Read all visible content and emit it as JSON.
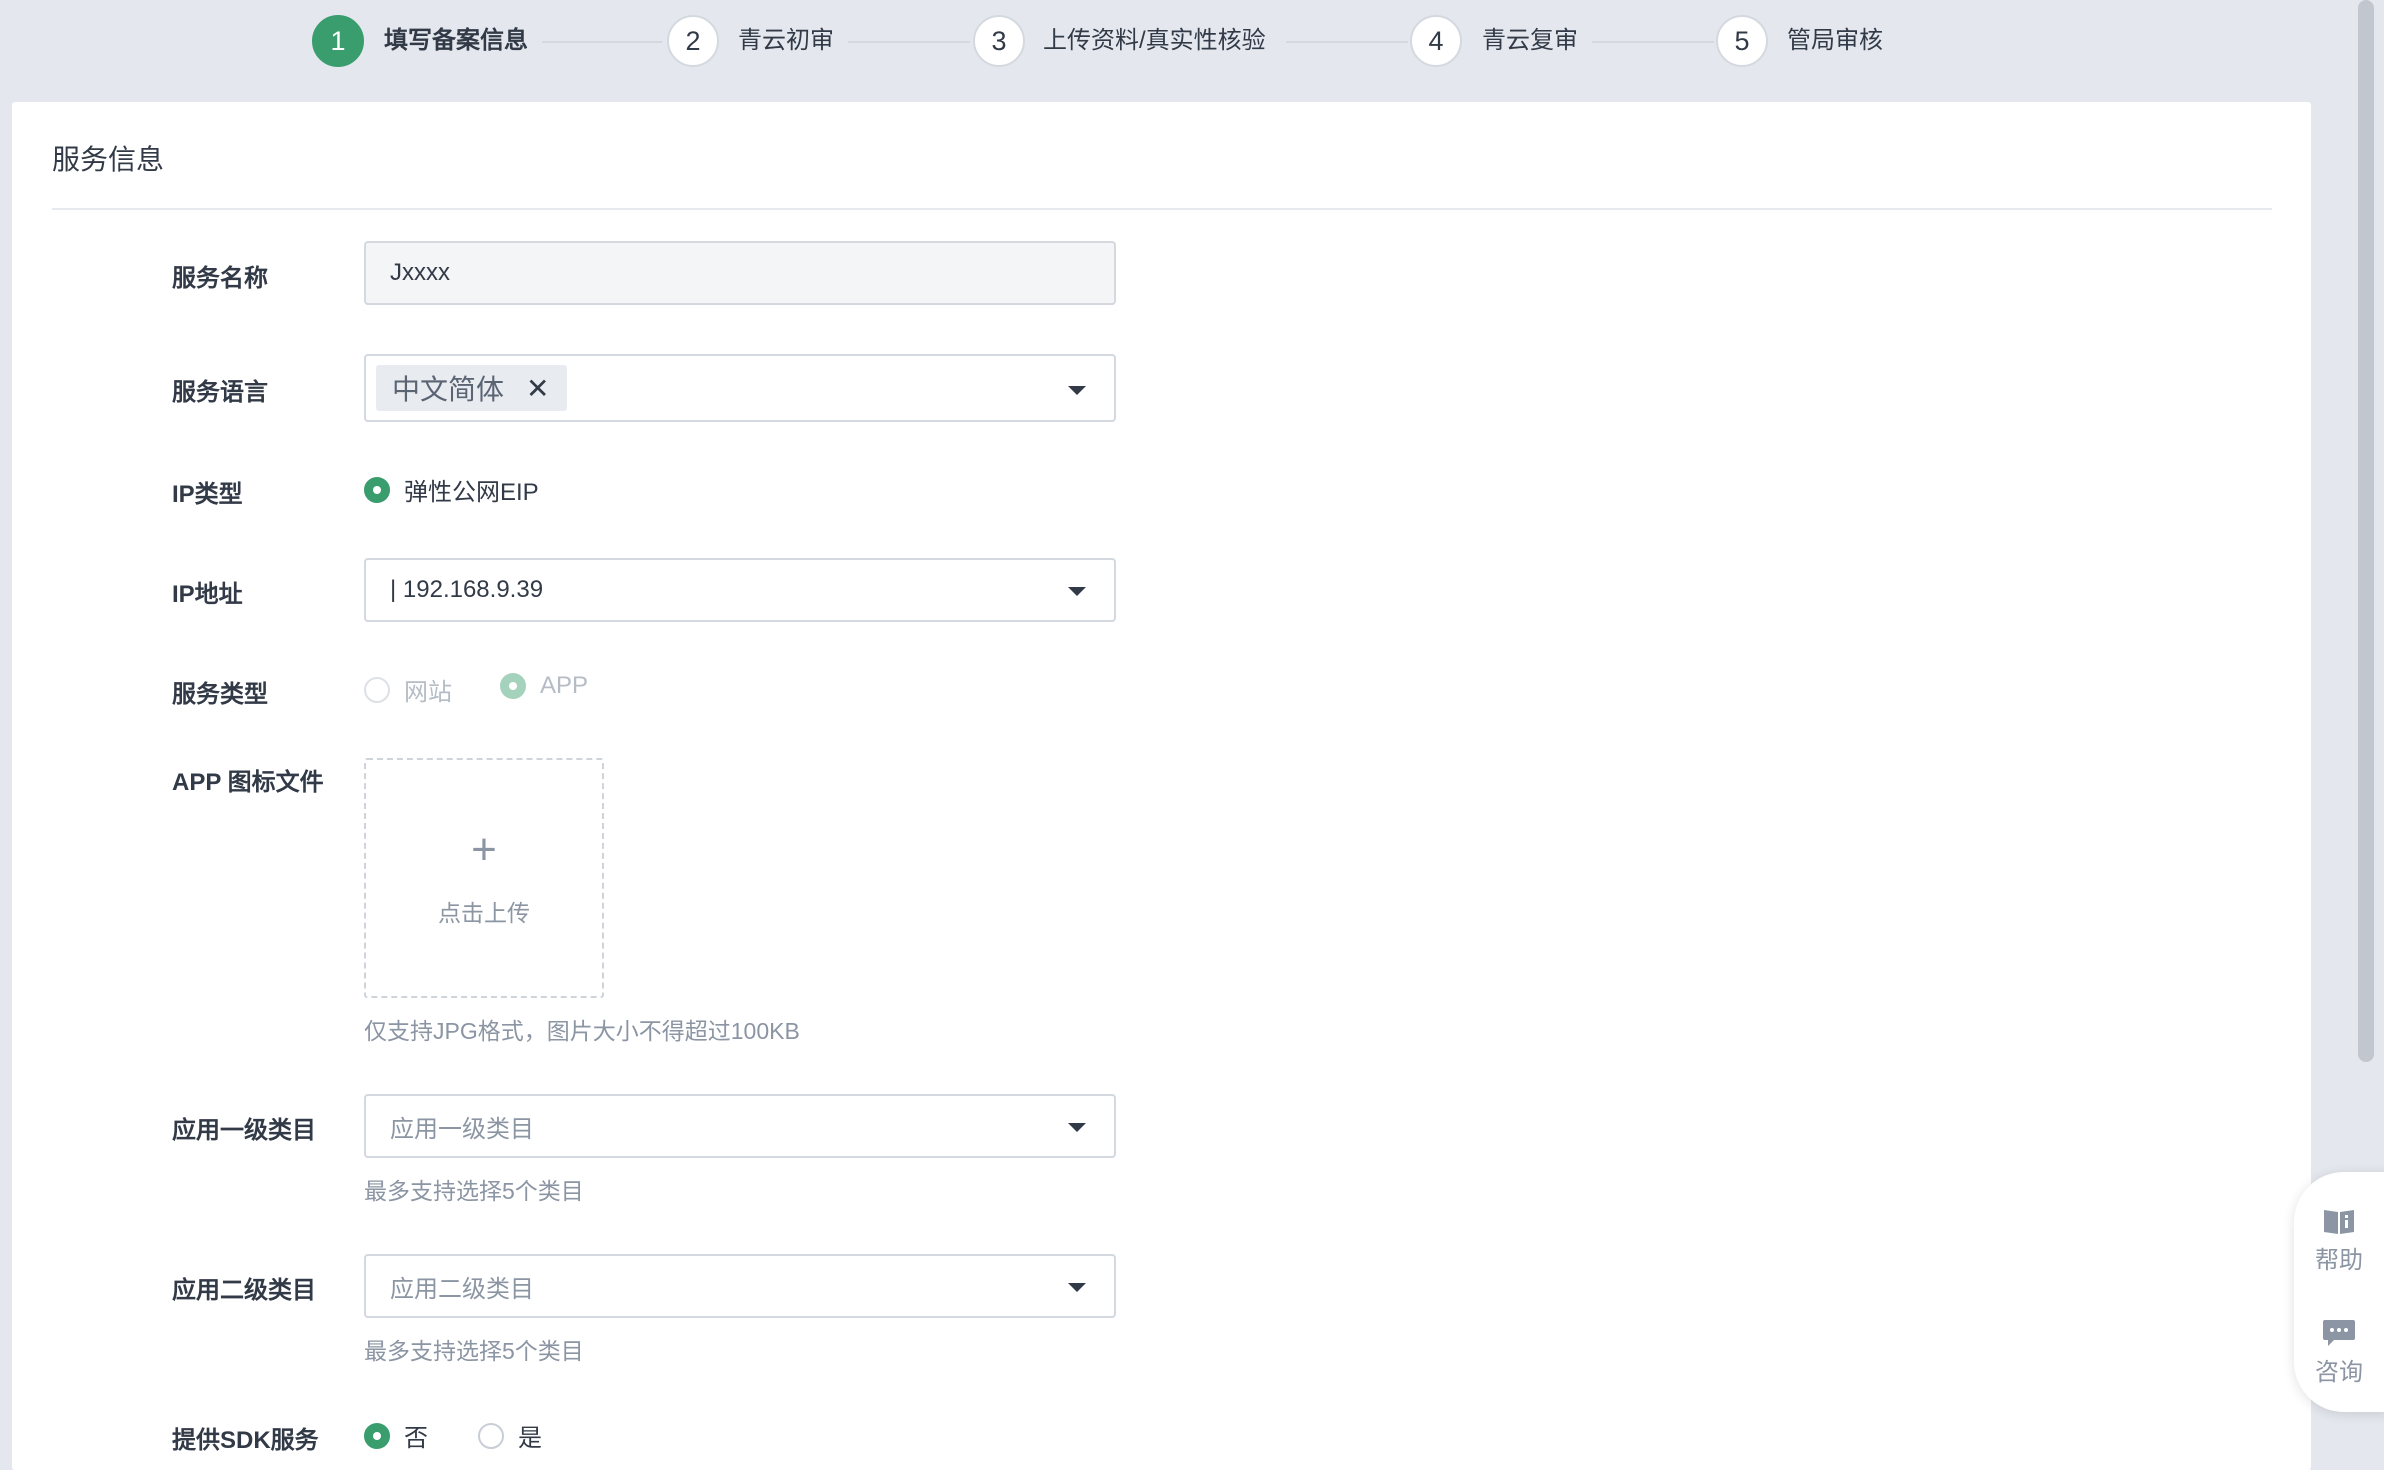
{
  "steps": [
    {
      "number": "1",
      "label": "填写备案信息",
      "active": true
    },
    {
      "number": "2",
      "label": "青云初审"
    },
    {
      "number": "3",
      "label": "上传资料/真实性核验"
    },
    {
      "number": "4",
      "label": "青云复审"
    },
    {
      "number": "5",
      "label": "管局审核"
    }
  ],
  "section": {
    "title": "服务信息"
  },
  "form": {
    "service_name": {
      "label": "服务名称",
      "value": "Jxxxx"
    },
    "service_language": {
      "label": "服务语言",
      "tag": "中文简体",
      "tag_remove": "✕"
    },
    "ip_type": {
      "label": "IP类型",
      "option": "弹性公网EIP",
      "selected": true
    },
    "ip_address": {
      "label": "IP地址",
      "value": "| 192.168.9.39"
    },
    "service_type": {
      "label": "服务类型",
      "options": [
        {
          "label": "网站",
          "selected": false,
          "disabled": true
        },
        {
          "label": "APP",
          "selected": true,
          "disabled": true
        }
      ]
    },
    "app_icon": {
      "label": "APP 图标文件",
      "upload_plus": "+",
      "upload_text": "点击上传",
      "hint": "仅支持JPG格式，图片大小不得超过100KB"
    },
    "category_level1": {
      "label": "应用一级类目",
      "placeholder": "应用一级类目",
      "hint": "最多支持选择5个类目"
    },
    "category_level2": {
      "label": "应用二级类目",
      "placeholder": "应用二级类目",
      "hint": "最多支持选择5个类目"
    },
    "sdk_service": {
      "label": "提供SDK服务",
      "options": [
        {
          "label": "否",
          "selected": true
        },
        {
          "label": "是",
          "selected": false
        }
      ]
    }
  },
  "float_panel": {
    "help": {
      "label": "帮助",
      "icon": "book-icon"
    },
    "consult": {
      "label": "咨询",
      "icon": "chat-bubble-icon"
    }
  },
  "colors": {
    "accent": "#3a9d6e",
    "background": "#e4e8ee",
    "border": "#d4d9e0",
    "muted": "#8b95a3"
  }
}
